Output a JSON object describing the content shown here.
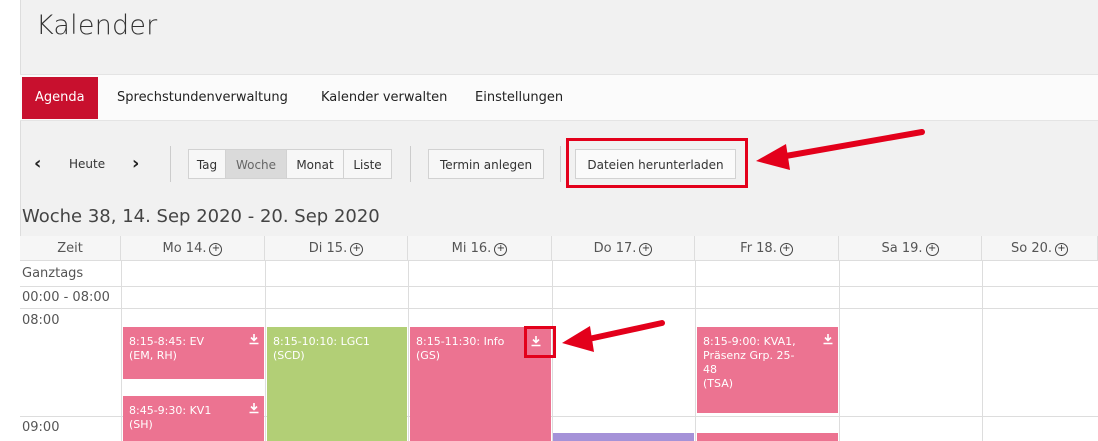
{
  "app": {
    "title": "Kalender"
  },
  "nav": [
    {
      "label": "Agenda",
      "active": true
    },
    {
      "label": "Sprechstundenverwaltung"
    },
    {
      "label": "Kalender verwalten"
    },
    {
      "label": "Einstellungen"
    }
  ],
  "toolbar": {
    "today": "Heute",
    "views": [
      "Tag",
      "Woche",
      "Monat",
      "Liste"
    ],
    "active_view": "Woche",
    "new_event": "Termin anlegen",
    "download": "Dateien herunterladen"
  },
  "week": {
    "title": "Woche 38, 14. Sep 2020 - 20. Sep 2020",
    "columns": [
      "Zeit",
      "Mo 14.",
      "Di 15.",
      "Mi 16.",
      "Do 17.",
      "Fr 18.",
      "Sa 19.",
      "So 20."
    ],
    "rows": [
      "Ganztags",
      "00:00 - 08:00",
      "08:00",
      "09:00"
    ]
  },
  "events": [
    {
      "line1": "8:15-8:45: EV",
      "line2": "(EM, RH)"
    },
    {
      "line1": "8:45-9:30: KV1",
      "line2": "(SH)"
    },
    {
      "line1": "8:15-10:10: LGC1",
      "line2": "(SCD)"
    },
    {
      "line1": "8:15-11:30: Info",
      "line2": "(GS)"
    },
    {
      "line1": "8:15-9:00: KVA1,",
      "line2": "Präsenz Grp. 25-",
      "line3": "48",
      "line4": "(TSA)"
    }
  ],
  "colors": {
    "accent": "#c8102e",
    "event_pink": "#ec7391",
    "event_green": "#b2cf76",
    "event_purple": "#a592d8",
    "highlight": "#e3001b"
  },
  "icons": [
    "chevron-left-icon",
    "chevron-right-icon",
    "plus-circle-icon",
    "download-icon",
    "arrow-annotation-icon"
  ]
}
